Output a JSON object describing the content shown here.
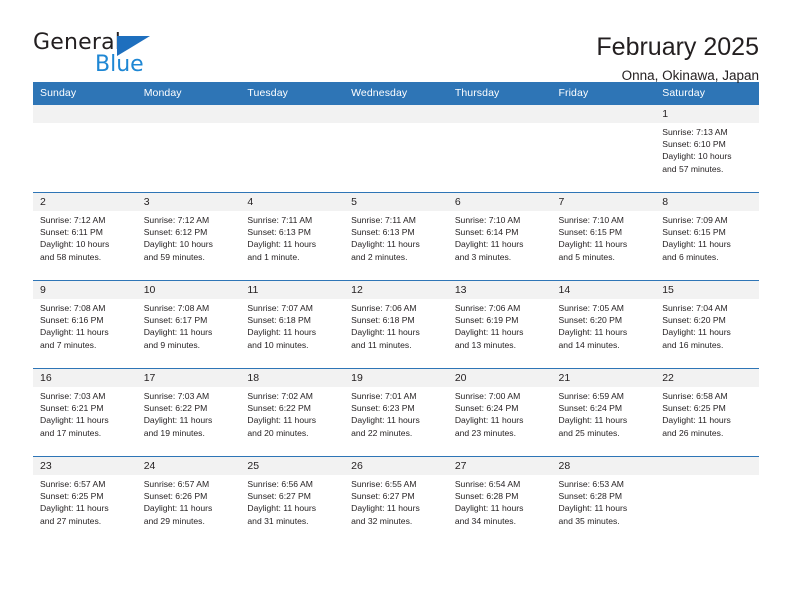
{
  "brand": {
    "name_top": "General",
    "name_bottom": "Blue",
    "accent_blue": "#1e87d4",
    "triangle_blue": "#1e6fbe"
  },
  "header": {
    "month_title": "February 2025",
    "location": "Onna, Okinawa, Japan",
    "header_bg": "#2e75b6",
    "daynum_bg": "#f2f2f2"
  },
  "weekdays": [
    "Sunday",
    "Monday",
    "Tuesday",
    "Wednesday",
    "Thursday",
    "Friday",
    "Saturday"
  ],
  "weeks": [
    [
      {
        "day": "",
        "empty": true,
        "sunrise": "",
        "sunset": "",
        "daylight1": "",
        "daylight2": ""
      },
      {
        "day": "",
        "empty": true,
        "sunrise": "",
        "sunset": "",
        "daylight1": "",
        "daylight2": ""
      },
      {
        "day": "",
        "empty": true,
        "sunrise": "",
        "sunset": "",
        "daylight1": "",
        "daylight2": ""
      },
      {
        "day": "",
        "empty": true,
        "sunrise": "",
        "sunset": "",
        "daylight1": "",
        "daylight2": ""
      },
      {
        "day": "",
        "empty": true,
        "sunrise": "",
        "sunset": "",
        "daylight1": "",
        "daylight2": ""
      },
      {
        "day": "",
        "empty": true,
        "sunrise": "",
        "sunset": "",
        "daylight1": "",
        "daylight2": ""
      },
      {
        "day": "1",
        "empty": false,
        "sunrise": "Sunrise: 7:13 AM",
        "sunset": "Sunset: 6:10 PM",
        "daylight1": "Daylight: 10 hours",
        "daylight2": "and 57 minutes."
      }
    ],
    [
      {
        "day": "2",
        "empty": false,
        "sunrise": "Sunrise: 7:12 AM",
        "sunset": "Sunset: 6:11 PM",
        "daylight1": "Daylight: 10 hours",
        "daylight2": "and 58 minutes."
      },
      {
        "day": "3",
        "empty": false,
        "sunrise": "Sunrise: 7:12 AM",
        "sunset": "Sunset: 6:12 PM",
        "daylight1": "Daylight: 10 hours",
        "daylight2": "and 59 minutes."
      },
      {
        "day": "4",
        "empty": false,
        "sunrise": "Sunrise: 7:11 AM",
        "sunset": "Sunset: 6:13 PM",
        "daylight1": "Daylight: 11 hours",
        "daylight2": "and 1 minute."
      },
      {
        "day": "5",
        "empty": false,
        "sunrise": "Sunrise: 7:11 AM",
        "sunset": "Sunset: 6:13 PM",
        "daylight1": "Daylight: 11 hours",
        "daylight2": "and 2 minutes."
      },
      {
        "day": "6",
        "empty": false,
        "sunrise": "Sunrise: 7:10 AM",
        "sunset": "Sunset: 6:14 PM",
        "daylight1": "Daylight: 11 hours",
        "daylight2": "and 3 minutes."
      },
      {
        "day": "7",
        "empty": false,
        "sunrise": "Sunrise: 7:10 AM",
        "sunset": "Sunset: 6:15 PM",
        "daylight1": "Daylight: 11 hours",
        "daylight2": "and 5 minutes."
      },
      {
        "day": "8",
        "empty": false,
        "sunrise": "Sunrise: 7:09 AM",
        "sunset": "Sunset: 6:15 PM",
        "daylight1": "Daylight: 11 hours",
        "daylight2": "and 6 minutes."
      }
    ],
    [
      {
        "day": "9",
        "empty": false,
        "sunrise": "Sunrise: 7:08 AM",
        "sunset": "Sunset: 6:16 PM",
        "daylight1": "Daylight: 11 hours",
        "daylight2": "and 7 minutes."
      },
      {
        "day": "10",
        "empty": false,
        "sunrise": "Sunrise: 7:08 AM",
        "sunset": "Sunset: 6:17 PM",
        "daylight1": "Daylight: 11 hours",
        "daylight2": "and 9 minutes."
      },
      {
        "day": "11",
        "empty": false,
        "sunrise": "Sunrise: 7:07 AM",
        "sunset": "Sunset: 6:18 PM",
        "daylight1": "Daylight: 11 hours",
        "daylight2": "and 10 minutes."
      },
      {
        "day": "12",
        "empty": false,
        "sunrise": "Sunrise: 7:06 AM",
        "sunset": "Sunset: 6:18 PM",
        "daylight1": "Daylight: 11 hours",
        "daylight2": "and 11 minutes."
      },
      {
        "day": "13",
        "empty": false,
        "sunrise": "Sunrise: 7:06 AM",
        "sunset": "Sunset: 6:19 PM",
        "daylight1": "Daylight: 11 hours",
        "daylight2": "and 13 minutes."
      },
      {
        "day": "14",
        "empty": false,
        "sunrise": "Sunrise: 7:05 AM",
        "sunset": "Sunset: 6:20 PM",
        "daylight1": "Daylight: 11 hours",
        "daylight2": "and 14 minutes."
      },
      {
        "day": "15",
        "empty": false,
        "sunrise": "Sunrise: 7:04 AM",
        "sunset": "Sunset: 6:20 PM",
        "daylight1": "Daylight: 11 hours",
        "daylight2": "and 16 minutes."
      }
    ],
    [
      {
        "day": "16",
        "empty": false,
        "sunrise": "Sunrise: 7:03 AM",
        "sunset": "Sunset: 6:21 PM",
        "daylight1": "Daylight: 11 hours",
        "daylight2": "and 17 minutes."
      },
      {
        "day": "17",
        "empty": false,
        "sunrise": "Sunrise: 7:03 AM",
        "sunset": "Sunset: 6:22 PM",
        "daylight1": "Daylight: 11 hours",
        "daylight2": "and 19 minutes."
      },
      {
        "day": "18",
        "empty": false,
        "sunrise": "Sunrise: 7:02 AM",
        "sunset": "Sunset: 6:22 PM",
        "daylight1": "Daylight: 11 hours",
        "daylight2": "and 20 minutes."
      },
      {
        "day": "19",
        "empty": false,
        "sunrise": "Sunrise: 7:01 AM",
        "sunset": "Sunset: 6:23 PM",
        "daylight1": "Daylight: 11 hours",
        "daylight2": "and 22 minutes."
      },
      {
        "day": "20",
        "empty": false,
        "sunrise": "Sunrise: 7:00 AM",
        "sunset": "Sunset: 6:24 PM",
        "daylight1": "Daylight: 11 hours",
        "daylight2": "and 23 minutes."
      },
      {
        "day": "21",
        "empty": false,
        "sunrise": "Sunrise: 6:59 AM",
        "sunset": "Sunset: 6:24 PM",
        "daylight1": "Daylight: 11 hours",
        "daylight2": "and 25 minutes."
      },
      {
        "day": "22",
        "empty": false,
        "sunrise": "Sunrise: 6:58 AM",
        "sunset": "Sunset: 6:25 PM",
        "daylight1": "Daylight: 11 hours",
        "daylight2": "and 26 minutes."
      }
    ],
    [
      {
        "day": "23",
        "empty": false,
        "sunrise": "Sunrise: 6:57 AM",
        "sunset": "Sunset: 6:25 PM",
        "daylight1": "Daylight: 11 hours",
        "daylight2": "and 27 minutes."
      },
      {
        "day": "24",
        "empty": false,
        "sunrise": "Sunrise: 6:57 AM",
        "sunset": "Sunset: 6:26 PM",
        "daylight1": "Daylight: 11 hours",
        "daylight2": "and 29 minutes."
      },
      {
        "day": "25",
        "empty": false,
        "sunrise": "Sunrise: 6:56 AM",
        "sunset": "Sunset: 6:27 PM",
        "daylight1": "Daylight: 11 hours",
        "daylight2": "and 31 minutes."
      },
      {
        "day": "26",
        "empty": false,
        "sunrise": "Sunrise: 6:55 AM",
        "sunset": "Sunset: 6:27 PM",
        "daylight1": "Daylight: 11 hours",
        "daylight2": "and 32 minutes."
      },
      {
        "day": "27",
        "empty": false,
        "sunrise": "Sunrise: 6:54 AM",
        "sunset": "Sunset: 6:28 PM",
        "daylight1": "Daylight: 11 hours",
        "daylight2": "and 34 minutes."
      },
      {
        "day": "28",
        "empty": false,
        "sunrise": "Sunrise: 6:53 AM",
        "sunset": "Sunset: 6:28 PM",
        "daylight1": "Daylight: 11 hours",
        "daylight2": "and 35 minutes."
      },
      {
        "day": "",
        "empty": true,
        "sunrise": "",
        "sunset": "",
        "daylight1": "",
        "daylight2": ""
      }
    ]
  ]
}
